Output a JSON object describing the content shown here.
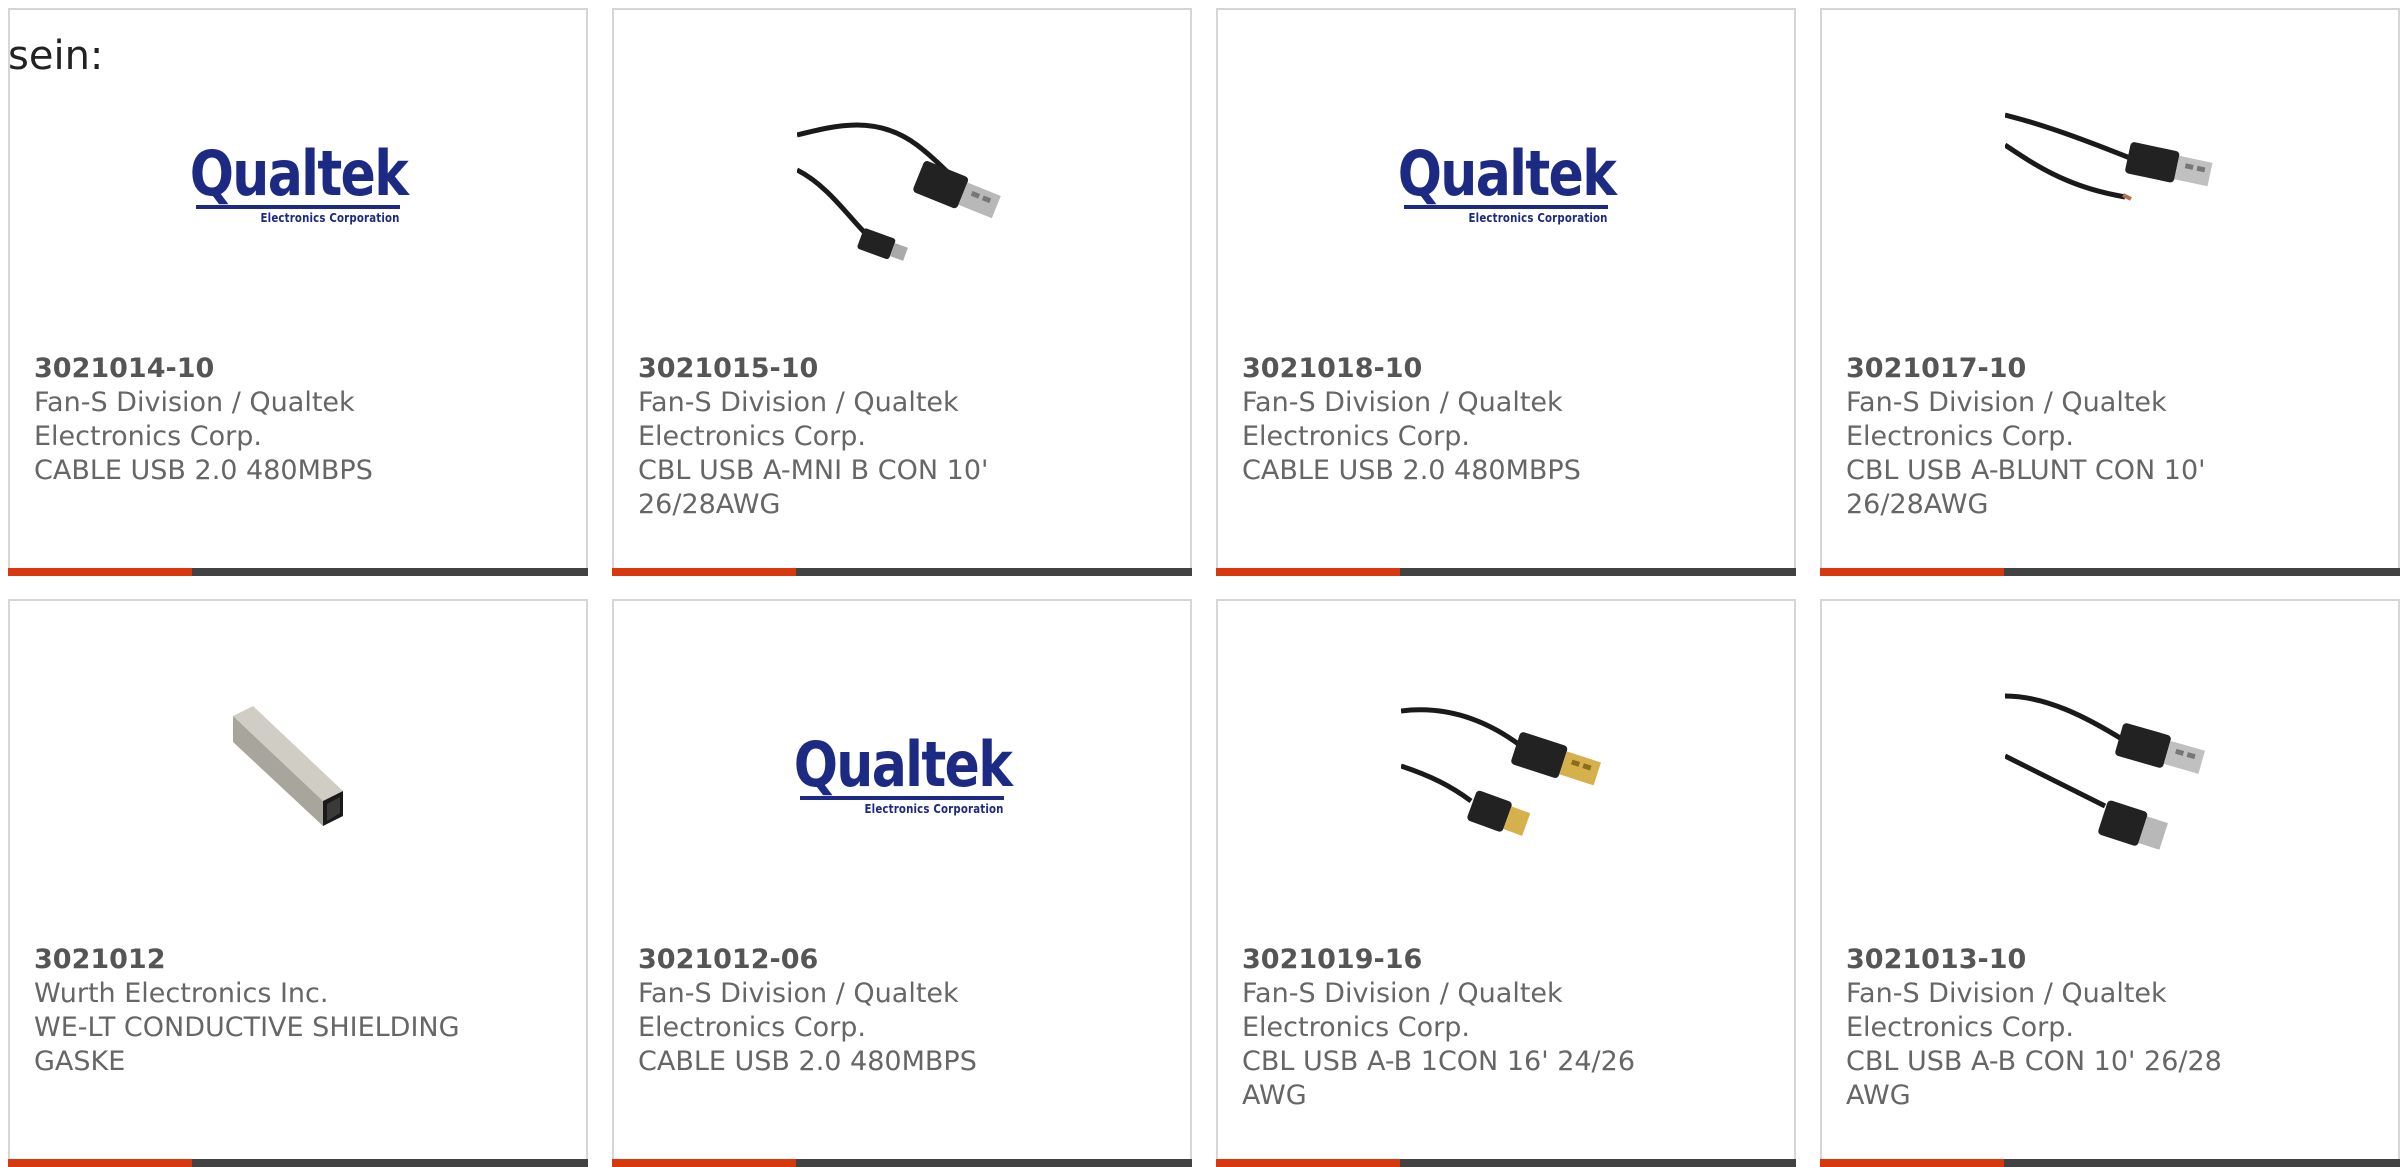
{
  "intro_text": "sein:",
  "products": [
    {
      "part": "3021014-10",
      "maker": "Fan-S Division / Qualtek Electronics Corp.",
      "desc": "CABLE USB 2.0 480MBPS",
      "image": "qualtek-logo",
      "logo_word": "Qualtek",
      "logo_sub": "Electronics Corporation"
    },
    {
      "part": "3021015-10",
      "maker": "Fan-S Division / Qualtek Electronics Corp.",
      "desc": "CBL USB A-MNI B CON 10' 26/28AWG",
      "image": "usb-a-mini-b-cable"
    },
    {
      "part": "3021018-10",
      "maker": "Fan-S Division / Qualtek Electronics Corp.",
      "desc": "CABLE USB 2.0 480MBPS",
      "image": "qualtek-logo",
      "logo_word": "Qualtek",
      "logo_sub": "Electronics Corporation"
    },
    {
      "part": "3021017-10",
      "maker": "Fan-S Division / Qualtek Electronics Corp.",
      "desc": "CBL USB A-BLUNT CON 10' 26/28AWG",
      "image": "usb-a-blunt-cable"
    },
    {
      "part": "3021012",
      "maker": "Wurth Electronics Inc.",
      "desc": "WE-LT CONDUCTIVE SHIELDING GASKE",
      "image": "shielding-gasket"
    },
    {
      "part": "3021012-06",
      "maker": "Fan-S Division / Qualtek Electronics Corp.",
      "desc": "CABLE USB 2.0 480MBPS",
      "image": "qualtek-logo",
      "logo_word": "Qualtek",
      "logo_sub": "Electronics Corporation"
    },
    {
      "part": "3021019-16",
      "maker": "Fan-S Division / Qualtek Electronics Corp.",
      "desc": "CBL USB A-B 1CON 16' 24/26 AWG",
      "image": "usb-a-b-gold-cable"
    },
    {
      "part": "3021013-10",
      "maker": "Fan-S Division / Qualtek Electronics Corp.",
      "desc": "CBL USB A-B CON 10' 26/28 AWG",
      "image": "usb-a-b-cable"
    }
  ],
  "colors": {
    "accent": "#d9380e",
    "bar": "#424242",
    "logo_blue": "#1c2a84",
    "text": "#666666"
  }
}
